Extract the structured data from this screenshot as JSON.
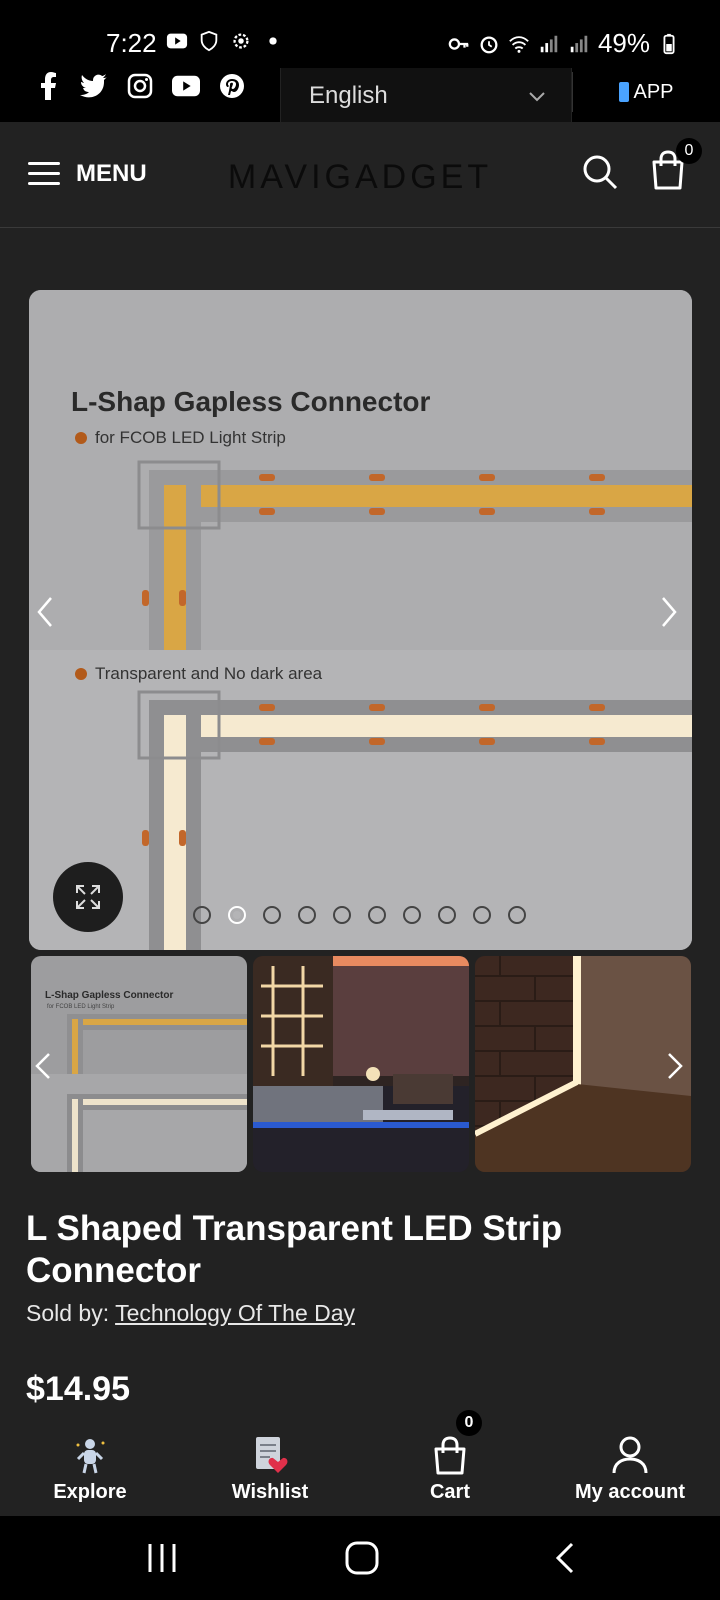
{
  "status_bar": {
    "time": "7:22",
    "battery": "49%"
  },
  "topbar": {
    "social": [
      "facebook-icon",
      "twitter-icon",
      "instagram-icon",
      "youtube-icon",
      "pinterest-icon"
    ],
    "language": "English",
    "app_label": "APP"
  },
  "header": {
    "menu_label": "MENU",
    "logo": "MAVIGADGET",
    "cart_count": "0"
  },
  "gallery": {
    "main_image": {
      "title": "L-Shap Gapless Connector",
      "bullet_1": "for FCOB LED Light Strip",
      "bullet_2": "Transparent and No dark area"
    },
    "dot_count": 10,
    "active_dot": 1,
    "thumbnails": [
      {
        "title": "L-Shap Gapless Connector",
        "subtitle": "for FCOB LED Light Strip"
      },
      {
        "scene": "living-room"
      },
      {
        "scene": "brick-wall-corner"
      }
    ]
  },
  "product": {
    "title": "L Shaped Transparent LED Strip Connector",
    "sold_by_label": "Sold by:",
    "seller": "Technology Of The Day",
    "price": "$14.95"
  },
  "bottom_nav": {
    "items": [
      {
        "label": "Explore",
        "icon": "explore-icon"
      },
      {
        "label": "Wishlist",
        "icon": "wishlist-icon"
      },
      {
        "label": "Cart",
        "icon": "cart-icon",
        "badge": "0"
      },
      {
        "label": "My account",
        "icon": "account-icon"
      }
    ]
  },
  "colors": {
    "background": "#222222",
    "image_bg": "#adadaf",
    "accent_led": "#e0a63c"
  }
}
